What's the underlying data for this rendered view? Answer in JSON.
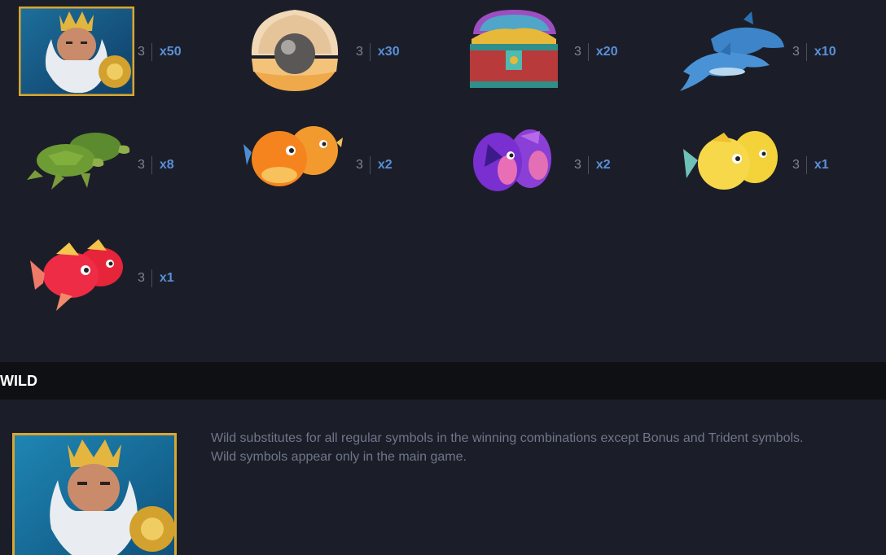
{
  "paytable": [
    {
      "symbol": "poseidon-icon",
      "count": "3",
      "multiplier": "x50"
    },
    {
      "symbol": "pearl-shell-icon",
      "count": "3",
      "multiplier": "x30"
    },
    {
      "symbol": "treasure-chest-icon",
      "count": "3",
      "multiplier": "x20"
    },
    {
      "symbol": "dolphins-icon",
      "count": "3",
      "multiplier": "x10"
    },
    {
      "symbol": "turtles-icon",
      "count": "3",
      "multiplier": "x8"
    },
    {
      "symbol": "pufferfish-icon",
      "count": "3",
      "multiplier": "x2"
    },
    {
      "symbol": "purple-fish-icon",
      "count": "3",
      "multiplier": "x2"
    },
    {
      "symbol": "yellow-fish-icon",
      "count": "3",
      "multiplier": "x1"
    },
    {
      "symbol": "red-fish-icon",
      "count": "3",
      "multiplier": "x1"
    }
  ],
  "wild": {
    "title": "WILD",
    "lines": [
      "Wild substitutes for all regular symbols in the winning combinations except Bonus and Trident symbols.",
      "Wild symbols appear only in the main game."
    ]
  },
  "colors": {
    "background": "#1b1e29",
    "header_bar": "#0f1014",
    "multiplier": "#5a8fd8",
    "count": "#7e8493",
    "description": "#6f7689"
  }
}
